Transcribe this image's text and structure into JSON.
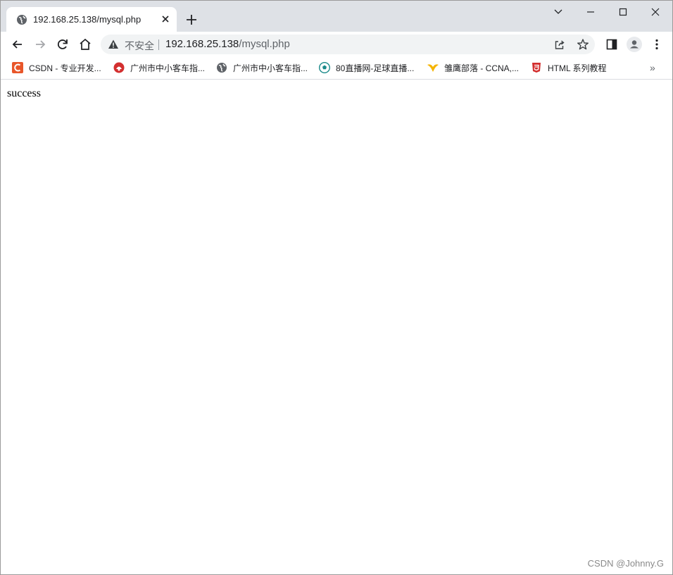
{
  "tab": {
    "title": "192.168.25.138/mysql.php"
  },
  "omnibox": {
    "security_label": "不安全",
    "url_host": "192.168.25.138",
    "url_path": "/mysql.php"
  },
  "bookmarks": [
    {
      "label": "CSDN - 专业开发...",
      "icon": "csdn-icon",
      "color": "#e8562a"
    },
    {
      "label": "广州市中小客车指...",
      "icon": "car-plate-icon",
      "color": "#d32f2f"
    },
    {
      "label": "广州市中小客车指...",
      "icon": "globe-icon",
      "color": "#5f6368"
    },
    {
      "label": "80直播网-足球直播...",
      "icon": "soccer-icon",
      "color": "#1a8a8a"
    },
    {
      "label": "雏鹰部落 - CCNA,...",
      "icon": "eagle-icon",
      "color": "#f5b400"
    },
    {
      "label": "HTML 系列教程",
      "icon": "html-icon",
      "color": "#d32f2f"
    }
  ],
  "bookmarks_more": "»",
  "page": {
    "body_text": "success"
  },
  "watermark": "CSDN @Johnny.G"
}
